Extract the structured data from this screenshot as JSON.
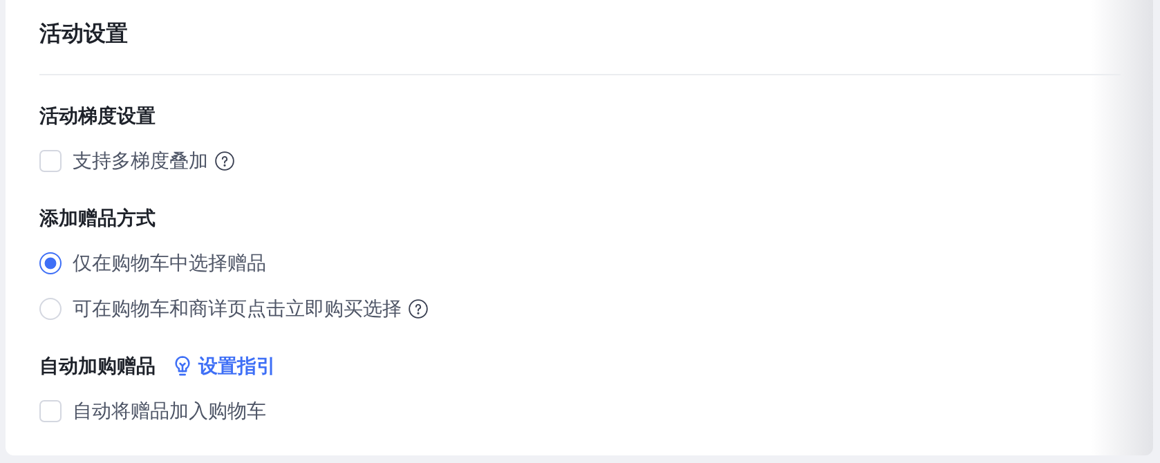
{
  "card": {
    "title": "活动设置",
    "sections": [
      {
        "heading": "活动梯度设置",
        "options": [
          {
            "kind": "checkbox",
            "label": "支持多梯度叠加",
            "checked": false,
            "help": true
          }
        ]
      },
      {
        "heading": "添加赠品方式",
        "options": [
          {
            "kind": "radio",
            "label": "仅在购物车中选择赠品",
            "selected": true,
            "help": false
          },
          {
            "kind": "radio",
            "label": "可在购物车和商详页点击立即购买选择",
            "selected": false,
            "help": true
          }
        ]
      },
      {
        "heading": "自动加购赠品",
        "guide_link": {
          "label": "设置指引"
        },
        "options": [
          {
            "kind": "checkbox",
            "label": "自动将赠品加入购物车",
            "checked": false,
            "help": false
          }
        ]
      }
    ]
  }
}
